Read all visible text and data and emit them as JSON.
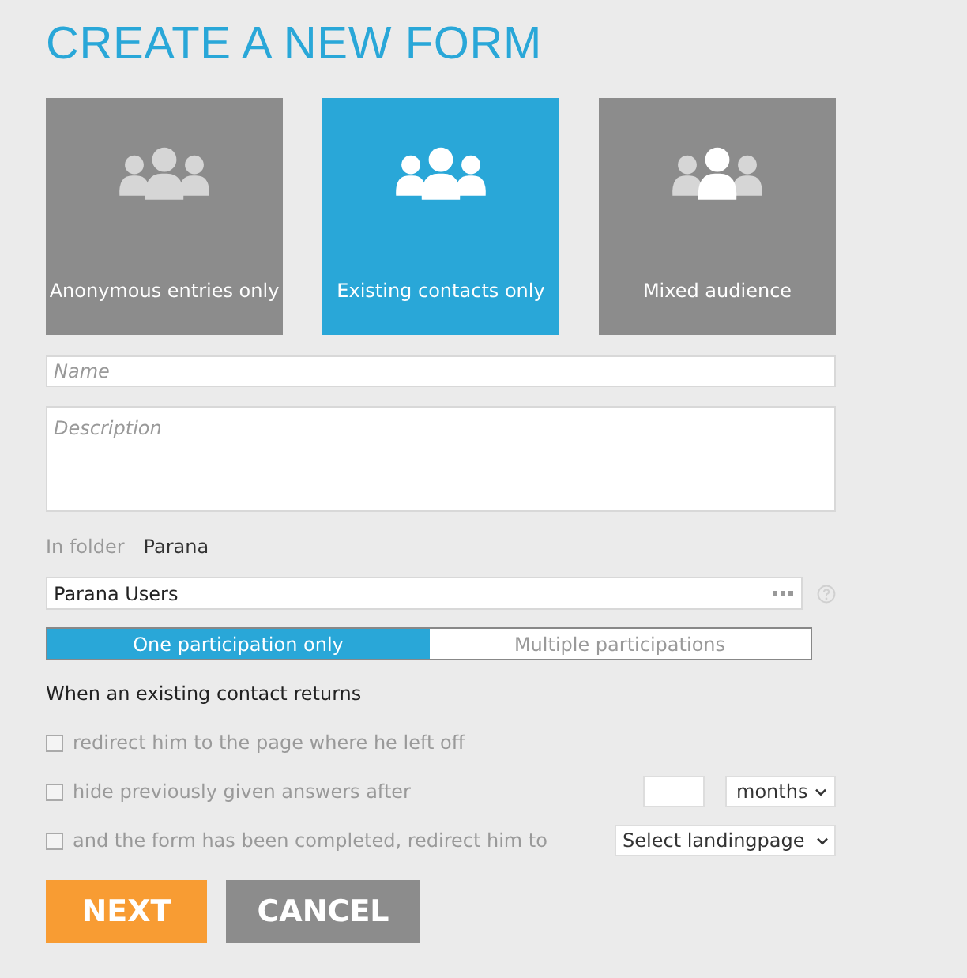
{
  "title": "CREATE A NEW FORM",
  "audience": [
    {
      "label": "Anonymous entries only",
      "kind": "anonymous",
      "selected": false
    },
    {
      "label": "Existing contacts only",
      "kind": "contacts",
      "selected": true
    },
    {
      "label": "Mixed audience",
      "kind": "mixed",
      "selected": false
    }
  ],
  "name_field": {
    "placeholder": "Name"
  },
  "description_field": {
    "placeholder": "Description"
  },
  "folder": {
    "label": "In folder",
    "value": "Parana"
  },
  "group_field": {
    "value": "Parana Users"
  },
  "participation": [
    {
      "label": "One participation only",
      "selected": true
    },
    {
      "label": "Multiple participations",
      "selected": false
    }
  ],
  "returns_heading": "When an existing contact returns",
  "options": [
    {
      "label": "redirect him to the page where he left off",
      "checked": false,
      "disabled": true,
      "kind": "plain"
    },
    {
      "label": "hide previously given answers after",
      "checked": false,
      "disabled": true,
      "kind": "period",
      "select": "months"
    },
    {
      "label": "and the form has been completed, redirect him to",
      "checked": false,
      "disabled": true,
      "kind": "page",
      "select": "Select landingpage"
    }
  ],
  "buttons": [
    {
      "label": "NEXT",
      "kind": "primary"
    },
    {
      "label": "CANCEL",
      "kind": "secondary"
    }
  ]
}
